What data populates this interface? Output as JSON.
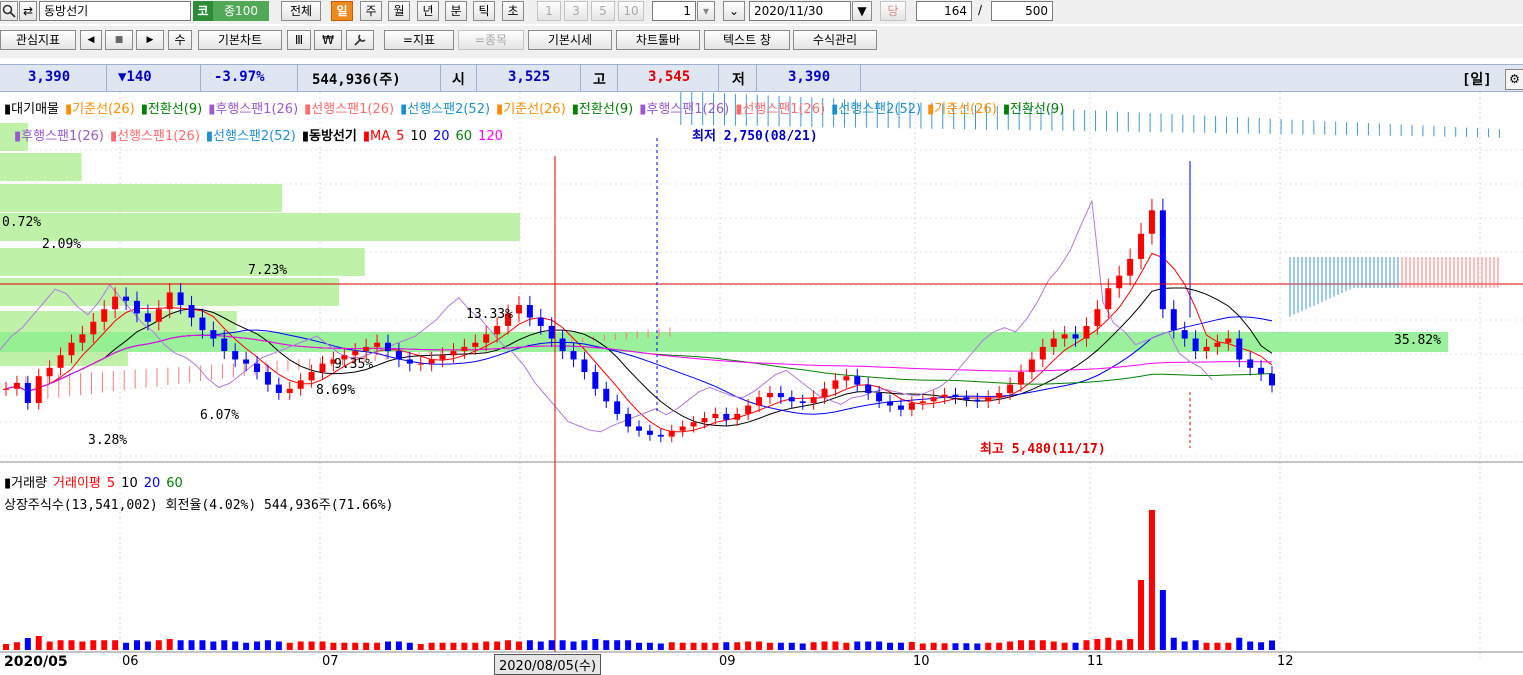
{
  "toolbar": {
    "stock_name": "동방선기",
    "market_badge": "코",
    "index_badge": "종100",
    "period_buttons": [
      "전체",
      "일",
      "주",
      "월",
      "년",
      "분",
      "틱",
      "초"
    ],
    "minute_buttons": [
      "1",
      "3",
      "5",
      "10"
    ],
    "interval_value": "1",
    "date_value": "2020/11/30",
    "next_label": "당",
    "count_value": "164",
    "count_separator": "/",
    "total_value": "500"
  },
  "toolbar2": {
    "buttons": [
      "관심지표",
      "◀",
      "■",
      "▶",
      "수",
      "기본차트",
      "Ⅲ",
      "₩",
      "🔧",
      "=지표",
      "=종목",
      "기본시세",
      "차트툴바",
      "텍스트 창",
      "수식관리"
    ]
  },
  "quote": {
    "price": "3,390",
    "change": "▼140",
    "change_pct": "-3.97%",
    "volume": "544,936(주)",
    "open_label": "시",
    "open": "3,525",
    "high_label": "고",
    "high": "3,545",
    "low_label": "저",
    "low": "3,390",
    "period_label": "[일]",
    "settings_icon": "gear-icon"
  },
  "legend": {
    "line1": [
      {
        "text": "대기매물",
        "color": "#000000"
      },
      {
        "text": "기준선(26)",
        "color": "#ff8c00"
      },
      {
        "text": "전환선(9)",
        "color": "#008000"
      },
      {
        "text": "후행스팬1(26)",
        "color": "#9b59d0"
      },
      {
        "text": "선행스팬1(26)",
        "color": "#ff6b6b"
      },
      {
        "text": "선행스팬2(52)",
        "color": "#1e90d0"
      },
      {
        "text": "기준선(26)",
        "color": "#ff8c00"
      },
      {
        "text": "전환선(9)",
        "color": "#008000"
      },
      {
        "text": "후행스팬1(26)",
        "color": "#9b59d0"
      },
      {
        "text": "선행스팬1(26)",
        "color": "#ff6b6b"
      },
      {
        "text": "선행스팬2(52)",
        "color": "#1e90d0"
      },
      {
        "text": "기준선(26)",
        "color": "#ff8c00"
      },
      {
        "text": "전환선(9)",
        "color": "#008000"
      }
    ],
    "line2": [
      {
        "text": "후행스팬1(26)",
        "color": "#9b59d0"
      },
      {
        "text": "선행스팬1(26)",
        "color": "#ff6b6b"
      },
      {
        "text": "선행스팬2(52)",
        "color": "#1e90d0"
      },
      {
        "text": "동방선기",
        "color": "#000000"
      },
      {
        "text": "MA",
        "color": "#ff0000"
      },
      {
        "text": "5",
        "color": "#ff0000"
      },
      {
        "text": "10",
        "color": "#000000"
      },
      {
        "text": "20",
        "color": "#0000ff"
      },
      {
        "text": "60",
        "color": "#008000"
      },
      {
        "text": "120",
        "color": "#ff00ff"
      }
    ],
    "low_marker": "최저 2,750(08/21)",
    "high_marker": "최고 5,480(11/17)"
  },
  "volume_legend": {
    "line1": [
      {
        "text": "거래량",
        "color": "#000000"
      },
      {
        "text": "거래이평",
        "color": "#ff0000"
      },
      {
        "text": "5",
        "color": "#ff0000"
      },
      {
        "text": "10",
        "color": "#000000"
      },
      {
        "text": "20",
        "color": "#0000ff"
      },
      {
        "text": "60",
        "color": "#008000"
      }
    ],
    "line2": "상장주식수(13,541,002) 회전율(4.02%) 544,936주(71.66%)"
  },
  "xaxis": {
    "labels": [
      "2020/05",
      "06",
      "07",
      "2020/08/05(수)",
      "09",
      "10",
      "11",
      "12"
    ]
  },
  "volume_profile": {
    "labels": [
      "0.72%",
      "2.09%",
      "7.23%",
      "13.33%",
      "9.35%",
      "8.69%",
      "6.07%",
      "3.28%",
      "35.82%"
    ],
    "pcts": [
      0.72,
      2.09,
      7.23,
      13.33,
      9.35,
      8.69,
      6.07,
      3.28,
      35.82
    ]
  },
  "chart_data": {
    "type": "candlestick",
    "title": "동방선기",
    "period": "daily",
    "x_start": "2020/05",
    "x_end": "2020/11/30",
    "ylim": [
      2500,
      6200
    ],
    "low": {
      "value": 2750,
      "date": "08/21"
    },
    "high": {
      "value": 5480,
      "date": "11/17"
    },
    "last": {
      "open": 3525,
      "high": 3545,
      "low": 3390,
      "close": 3390,
      "volume": 544936
    },
    "close_series": [
      3350,
      3420,
      3180,
      3500,
      3600,
      3750,
      3900,
      4000,
      4150,
      4300,
      4450,
      4400,
      4250,
      4150,
      4300,
      4500,
      4350,
      4200,
      4050,
      3950,
      3800,
      3700,
      3650,
      3550,
      3400,
      3300,
      3350,
      3450,
      3550,
      3650,
      3700,
      3750,
      3800,
      3850,
      3900,
      3800,
      3700,
      3650,
      3650,
      3700,
      3750,
      3800,
      3850,
      3900,
      4000,
      4100,
      4250,
      4350,
      4200,
      4100,
      3950,
      3800,
      3700,
      3550,
      3350,
      3200,
      3050,
      2900,
      2850,
      2800,
      2780,
      2850,
      2900,
      2950,
      3000,
      3050,
      2980,
      3050,
      3150,
      3250,
      3300,
      3250,
      3200,
      3180,
      3250,
      3350,
      3450,
      3500,
      3400,
      3300,
      3200,
      3150,
      3100,
      3180,
      3200,
      3250,
      3280,
      3250,
      3220,
      3200,
      3250,
      3300,
      3400,
      3550,
      3700,
      3850,
      3950,
      4000,
      3950,
      4100,
      4300,
      4550,
      4700,
      4900,
      5200,
      5480,
      4300,
      4050,
      3950,
      3800,
      3850,
      3900,
      3950,
      3700,
      3600,
      3530,
      3390
    ]
  }
}
